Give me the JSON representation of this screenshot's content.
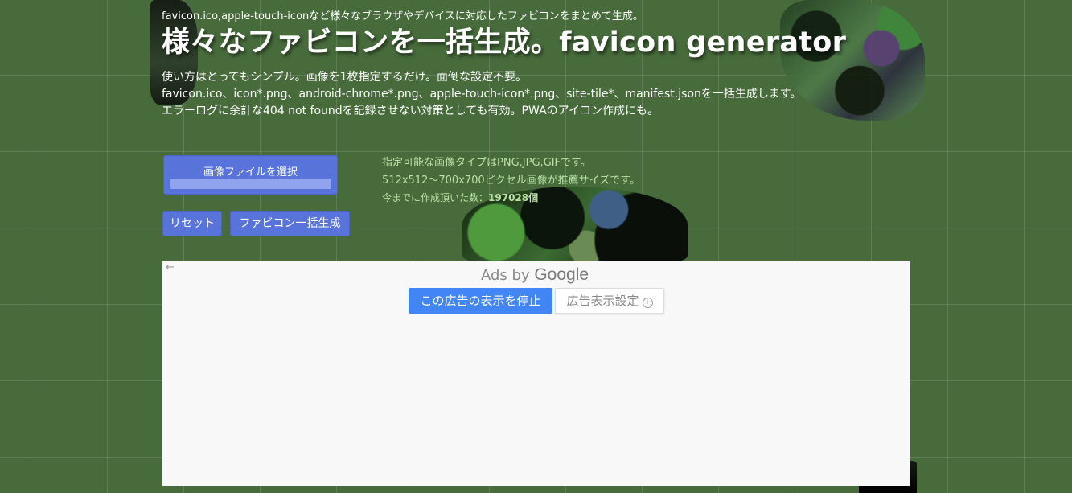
{
  "header": {
    "tagline": "favicon.ico,apple-touch-iconなど様々なブラウザやデバイスに対応したファビコンをまとめて生成。",
    "title": "様々なファビコンを一括生成。favicon generator"
  },
  "description": {
    "lines": [
      "使い方はとってもシンプル。画像を1枚指定するだけ。面倒な設定不要。",
      "favicon.ico、icon*.png、android-chrome*.png、apple-touch-icon*.png、site-tile*、manifest.jsonを一括生成します。",
      "エラーログに余計な404 not foundを記録させない対策としても有効。PWAのアイコン作成にも。"
    ]
  },
  "upload": {
    "label": "画像ファイルを選択"
  },
  "buttons": {
    "reset": "リセット",
    "generate": "ファビコン一括生成"
  },
  "info": {
    "types": "指定可能な画像タイプはPNG,JPG,GIFです。",
    "size": "512x512～700x700ピクセル画像が推薦サイズです。",
    "count_prefix": "今までに作成頂いた数：",
    "count": "197028",
    "count_suffix": "個"
  },
  "ad": {
    "back_icon": "←",
    "ads_by": "Ads by",
    "google": "Google",
    "stop_label": "この広告の表示を停止",
    "settings_label": "広告表示設定",
    "settings_icon": "i"
  },
  "colors": {
    "background": "#476b3b",
    "button": "#5873d9",
    "info_text": "#b9e2a4",
    "ad_stop": "#4285f4"
  }
}
